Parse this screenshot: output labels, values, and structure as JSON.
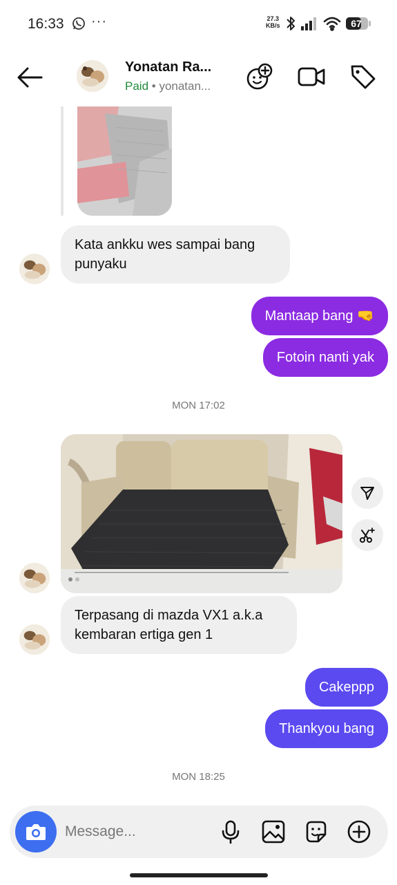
{
  "status_bar": {
    "time": "16:33",
    "more": "···",
    "speed_value": "27.3",
    "speed_unit": "KB/s",
    "battery": "67",
    "icons": [
      "whatsapp-icon",
      "bluetooth-icon",
      "signal-icon",
      "wifi-icon",
      "battery-icon"
    ]
  },
  "header": {
    "name": "Yonatan Ra...",
    "paid": "Paid",
    "handle": "• yonatan...",
    "icons": [
      "back-arrow-icon",
      "add-effect-icon",
      "video-call-icon",
      "tag-icon"
    ]
  },
  "messages": [
    {
      "from": "them",
      "type": "image"
    },
    {
      "from": "them",
      "text": "Kata ankku wes sampai bang punyaku"
    },
    {
      "from": "me",
      "text": "Mantaap bang 🤜"
    },
    {
      "from": "me",
      "text": "Fotoin nanti yak"
    },
    {
      "type": "timestamp",
      "text": "MON 17:02"
    },
    {
      "from": "them",
      "type": "image"
    },
    {
      "from": "them",
      "text": "Terpasang di mazda VX1 a.k.a kembaran ertiga gen 1"
    },
    {
      "from": "me",
      "text": "Cakeppp"
    },
    {
      "from": "me",
      "text": "Thankyou bang"
    },
    {
      "type": "timestamp",
      "text": "MON 18:25"
    }
  ],
  "composer": {
    "placeholder": "Message...",
    "icons": [
      "camera-icon",
      "microphone-icon",
      "gallery-icon",
      "sticker-icon",
      "add-icon"
    ]
  },
  "colors": {
    "outgoing_purple": "#8b2be2",
    "outgoing_indigo": "#5b4af0",
    "incoming": "#efefef",
    "paid_green": "#1f8a3a",
    "camera_blue": "#3d6ef0"
  }
}
